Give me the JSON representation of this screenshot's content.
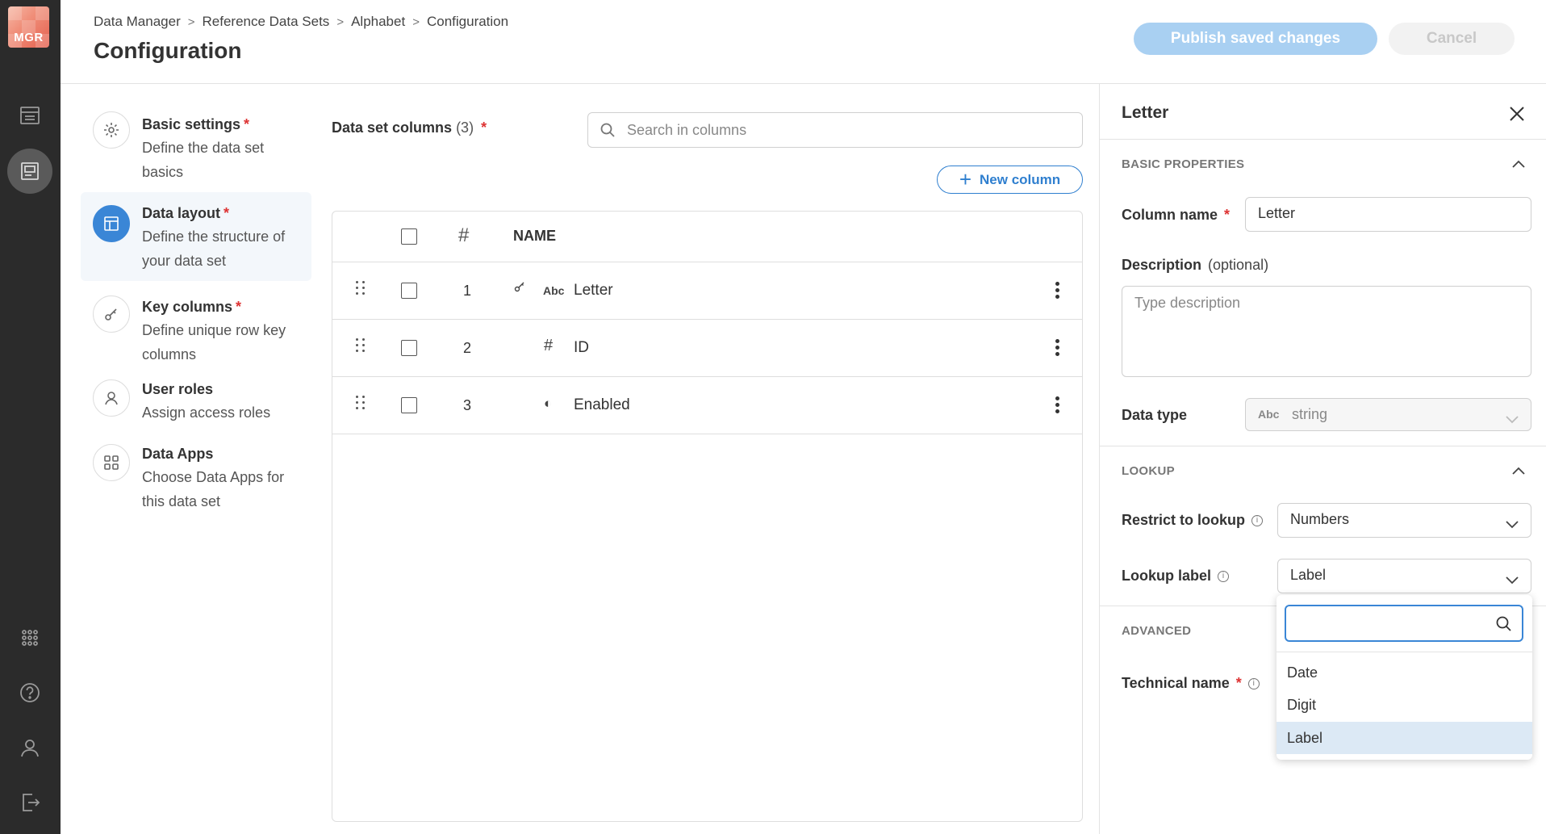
{
  "app": {
    "logo_text": "MGR"
  },
  "breadcrumb": [
    "Data Manager",
    "Reference Data Sets",
    "Alphabet",
    "Configuration"
  ],
  "page_title": "Configuration",
  "actions": {
    "publish": "Publish saved changes",
    "cancel": "Cancel"
  },
  "steps": [
    {
      "title": "Basic settings",
      "required": true,
      "desc": "Define the data set basics",
      "icon": "gear-icon"
    },
    {
      "title": "Data layout",
      "required": true,
      "desc": "Define the structure of your data set",
      "icon": "layout-icon",
      "active": true
    },
    {
      "title": "Key columns",
      "required": true,
      "desc": "Define unique row key columns",
      "icon": "key-icon"
    },
    {
      "title": "User roles",
      "required": false,
      "desc": "Assign access roles",
      "icon": "user-icon"
    },
    {
      "title": "Data Apps",
      "required": false,
      "desc": "Choose Data Apps for this data set",
      "icon": "apps-icon"
    }
  ],
  "columns": {
    "title": "Data set columns",
    "count": "(3)",
    "required_mark": "*",
    "search_placeholder": "Search in columns",
    "new_button": "New column",
    "header_hash": "#",
    "header_name": "NAME",
    "rows": [
      {
        "num": "1",
        "key": true,
        "type_icon": "Abc",
        "name": "Letter"
      },
      {
        "num": "2",
        "key": false,
        "type_icon": "#",
        "name": "ID"
      },
      {
        "num": "3",
        "key": false,
        "type_icon": "◐",
        "name": "Enabled"
      }
    ]
  },
  "panel": {
    "title": "Letter",
    "basic_section": "BASIC PROPERTIES",
    "column_name_label": "Column name",
    "column_name_value": "Letter",
    "description_label": "Description",
    "description_optional": "(optional)",
    "description_placeholder": "Type description",
    "data_type_label": "Data type",
    "data_type_prefix": "Abc",
    "data_type_value": "string",
    "lookup_section": "LOOKUP",
    "restrict_label": "Restrict to lookup",
    "restrict_value": "Numbers",
    "lookup_label_label": "Lookup label",
    "lookup_label_value": "Label",
    "advanced_section": "ADVANCED",
    "technical_name_label": "Technical name",
    "dropdown_options": [
      "Date",
      "Digit",
      "Label"
    ],
    "dropdown_selected": "Label"
  },
  "colors": {
    "accent": "#3a86d6",
    "publish_bg": "#a9d0f2",
    "rail_bg": "#2b2b2b",
    "required": "#dd3333"
  }
}
